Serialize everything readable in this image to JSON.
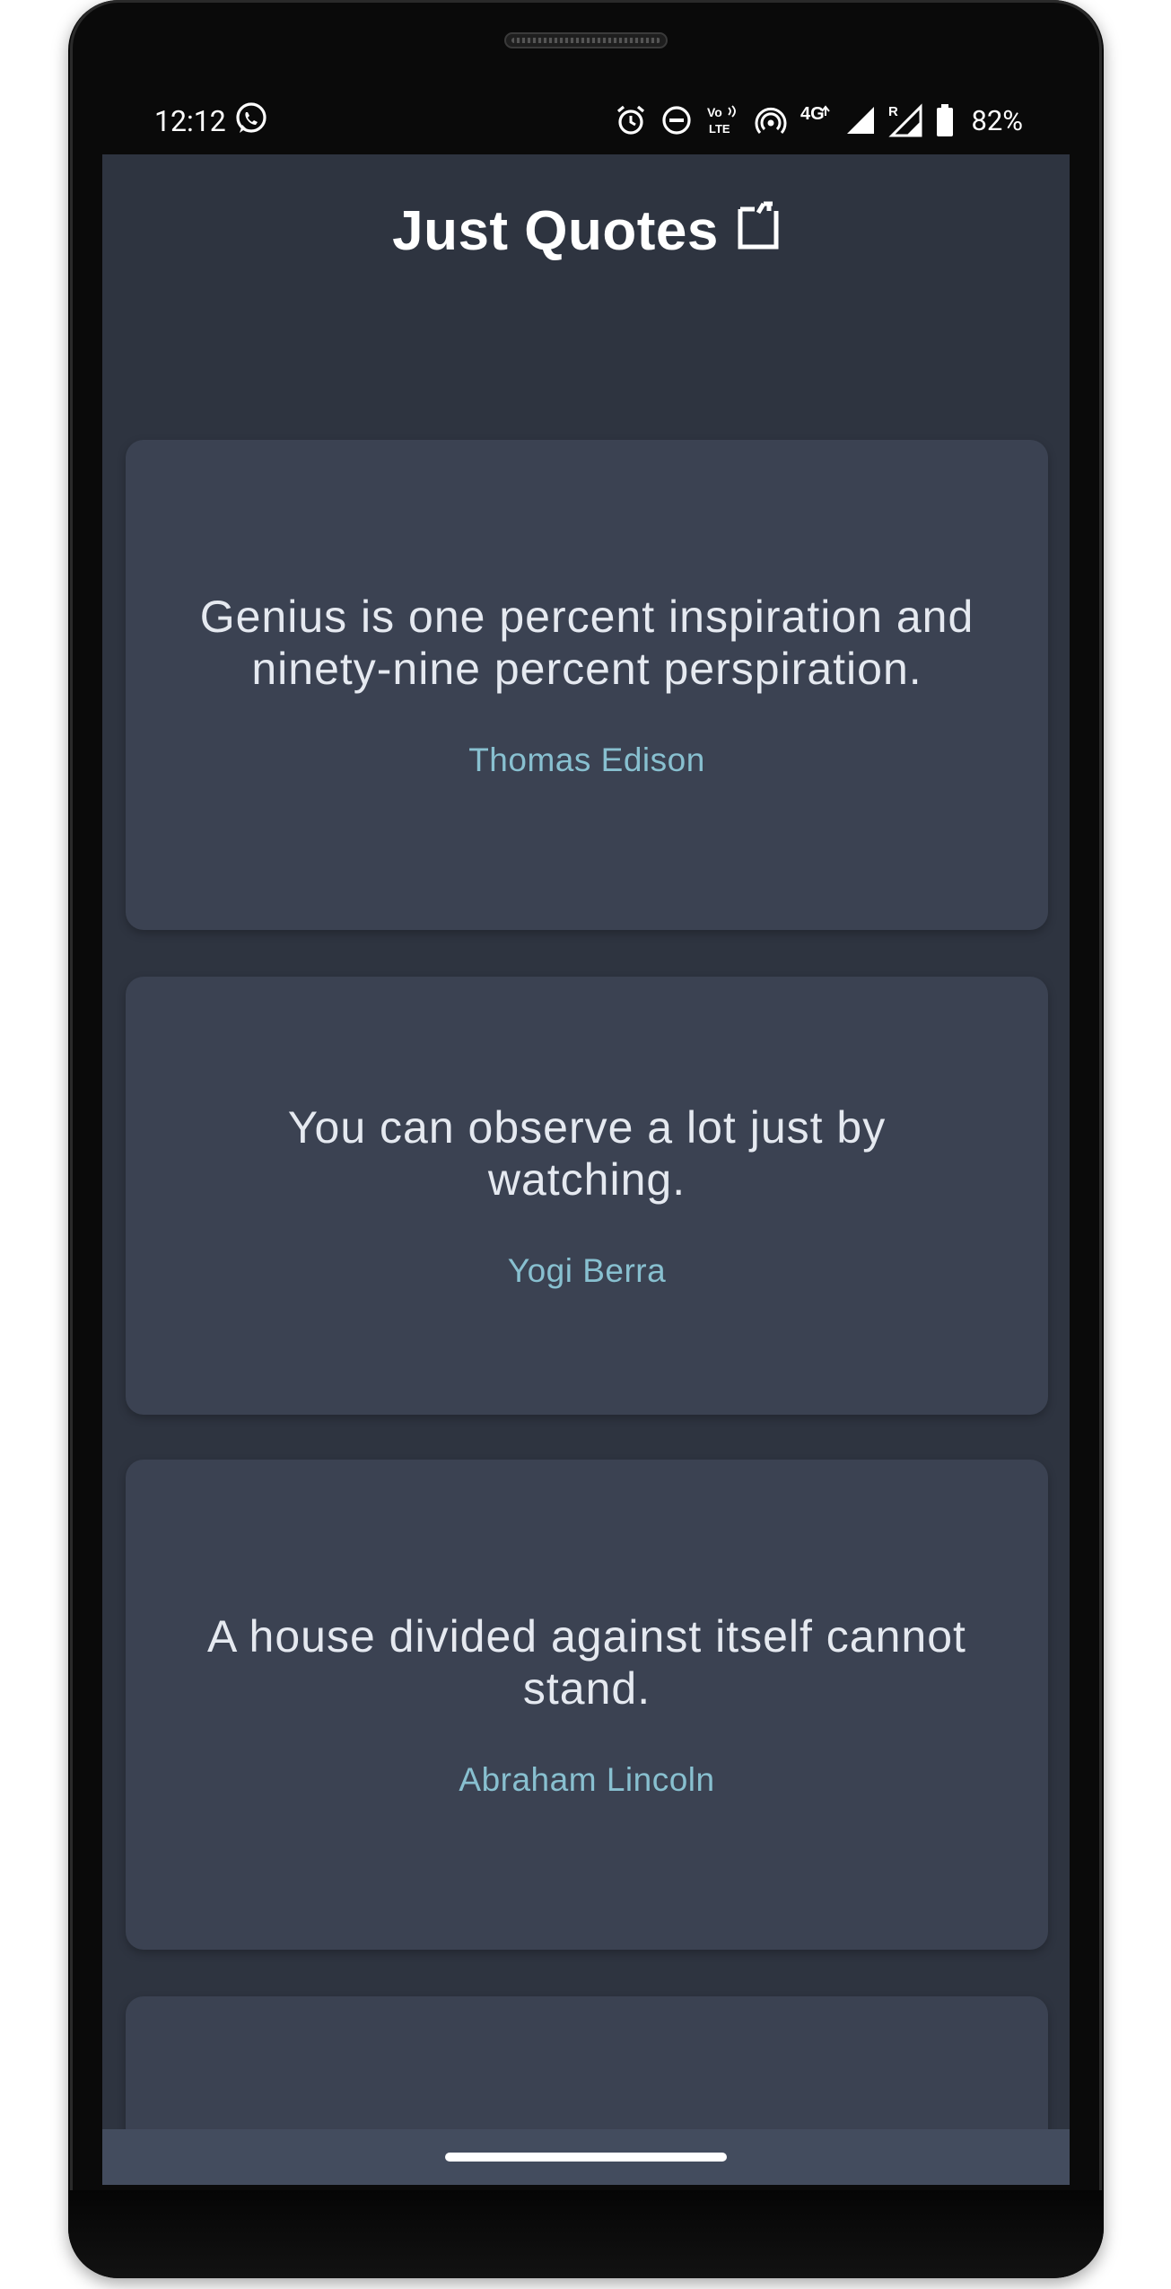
{
  "status_bar": {
    "time": "12:12",
    "battery_percent": "82%",
    "icons": [
      "whatsapp-icon",
      "alarm-icon",
      "do-not-disturb-icon",
      "volte-icon",
      "hotspot-icon",
      "4g-icon",
      "signal-icon",
      "roaming-signal-icon",
      "battery-icon"
    ],
    "volte_line1": "Vo",
    "volte_line2": "LTE",
    "network": "4G",
    "roaming": "R"
  },
  "app": {
    "title": "Just Quotes",
    "title_icon": "copy-icon"
  },
  "quotes": [
    {
      "text": "Genius is one percent inspiration and ninety-nine percent perspiration.",
      "author": "Thomas Edison"
    },
    {
      "text": "You can observe a lot just by watching.",
      "author": "Yogi Berra"
    },
    {
      "text": "A house divided against itself cannot stand.",
      "author": "Abraham Lincoln"
    }
  ],
  "colors": {
    "background": "#2e3440",
    "card": "#3b4252",
    "quote_text": "#e5e9f0",
    "author_text": "#88c0d0",
    "nav_bar": "#434c5e"
  }
}
